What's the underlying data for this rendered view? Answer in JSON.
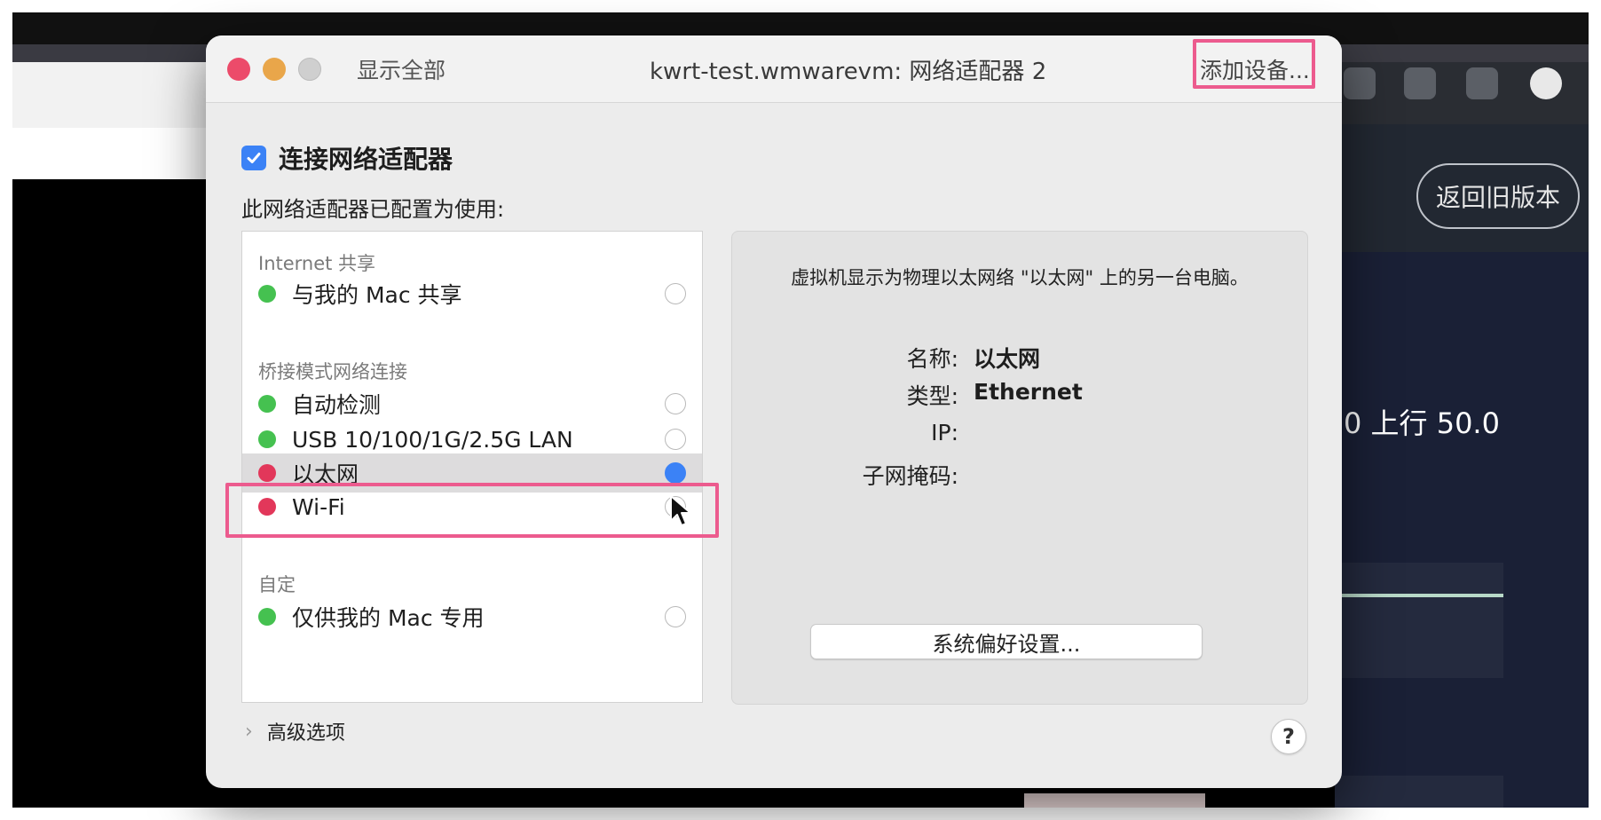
{
  "background": {
    "return_button": "返回旧版本",
    "speed_text": "0 上行 50.0",
    "icons": [
      "eyes-icon",
      "translate-icon",
      "lock-icon",
      "v-icon"
    ]
  },
  "window": {
    "show_all": "显示全部",
    "title": "kwrt-test.wmwarevm: 网络适配器 2",
    "add_device": "添加设备..."
  },
  "connect": {
    "checked": true,
    "label": "连接网络适配器"
  },
  "configured_label": "此网络适配器已配置为使用:",
  "sections": {
    "internet_sharing": {
      "title": "Internet 共享",
      "items": [
        {
          "label": "与我的 Mac 共享",
          "status": "green",
          "selected": false
        }
      ]
    },
    "bridged": {
      "title": "桥接模式网络连接",
      "items": [
        {
          "label": "自动检测",
          "status": "green",
          "selected": false
        },
        {
          "label": "USB 10/100/1G/2.5G LAN",
          "status": "green",
          "selected": false
        },
        {
          "label": "以太网",
          "status": "red",
          "selected": true
        },
        {
          "label": "Wi-Fi",
          "status": "red",
          "selected": false
        }
      ]
    },
    "custom": {
      "title": "自定",
      "items": [
        {
          "label": "仅供我的 Mac 专用",
          "status": "green",
          "selected": false
        }
      ]
    }
  },
  "info": {
    "description": "虚拟机显示为物理以太网络 \"以太网\" 上的另一台电脑。",
    "name_label": "名称:",
    "name_value": "以太网",
    "type_label": "类型:",
    "type_value": "Ethernet",
    "ip_label": "IP:",
    "ip_value": "",
    "subnet_label": "子网掩码:",
    "subnet_value": "",
    "system_prefs_button": "系统偏好设置..."
  },
  "advanced_label": "高级选项",
  "help_label": "?",
  "colors": {
    "highlight": "#ec5b8e",
    "status_green": "#45c150",
    "status_red": "#e2375a",
    "accent_blue": "#3b82f6"
  }
}
